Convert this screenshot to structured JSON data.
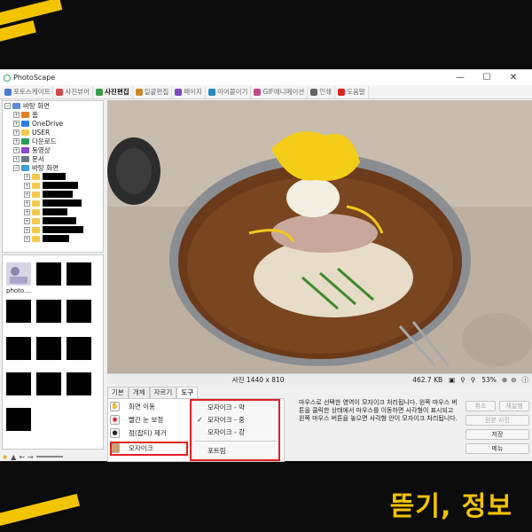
{
  "window": {
    "title": "PhotoScape"
  },
  "menubar": {
    "tabs": [
      {
        "label": "포토스케이프",
        "color": "#4a7bd0"
      },
      {
        "label": "사진뷰어",
        "color": "#d04a4a"
      },
      {
        "label": "사진편집",
        "color": "#3a9a4a",
        "active": true
      },
      {
        "label": "일괄편집",
        "color": "#c68a2a"
      },
      {
        "label": "페이지",
        "color": "#7a4ac0"
      },
      {
        "label": "이어붙이기",
        "color": "#2a8ac0"
      },
      {
        "label": "GIF애니메이션",
        "color": "#c04a8a"
      },
      {
        "label": "인쇄",
        "color": "#666666"
      },
      {
        "label": "도움말",
        "color": "#e02020"
      }
    ]
  },
  "tree": {
    "root_label": "바탕 화면",
    "items": [
      "홈",
      "OneDrive",
      "USER",
      "다운로드",
      "동영상",
      "문서",
      "바탕 화면"
    ]
  },
  "thumbnails": {
    "first_label": "photo...."
  },
  "status": {
    "size": "사진 1440 x 810",
    "filesize": "462.7 KB",
    "zoom": "53%"
  },
  "panel": {
    "tabs": [
      "기본",
      "개체",
      "자르기",
      "도구"
    ],
    "tools": [
      "화면 이동",
      "빨간 눈 보정",
      "점(잡티) 제거",
      "모자이크"
    ]
  },
  "dropdown": {
    "items": [
      "모자이크 - 약",
      "모자이크 - 중",
      "모자이크 - 강",
      "포트림"
    ],
    "checked_index": 1
  },
  "description": "마우스로 선택한 영역이 모자이크 처리됩니다. 왼쪽 마우스 버튼을 클릭한 상태에서 마우스를 이동하면 사각형이 표시되고 왼쪽 마우스 버튼을 놓으면 사각형 안이 모자이크 처리됩니다.",
  "buttons": {
    "cancel": "취소",
    "redo": "재실행",
    "original": "원본 사진",
    "save": "저장",
    "menu": "메뉴"
  },
  "brand": "뜯기, 정보",
  "colors": {
    "accent": "#f3c300",
    "highlight": "#e02020"
  }
}
